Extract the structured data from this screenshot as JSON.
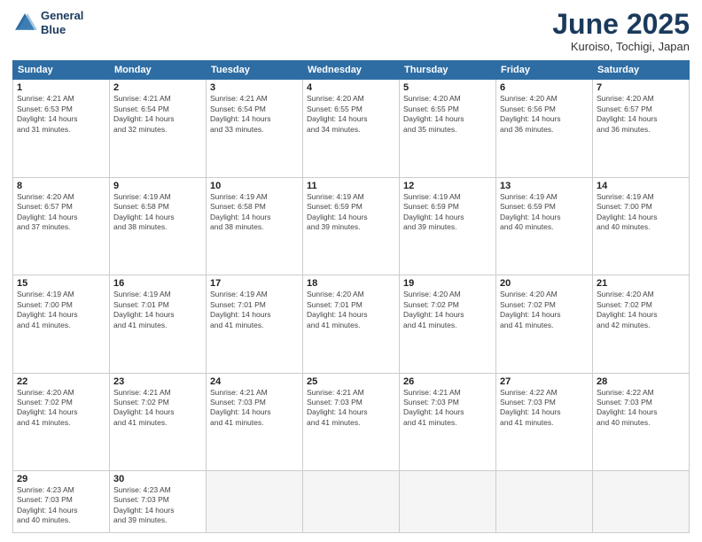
{
  "logo": {
    "line1": "General",
    "line2": "Blue"
  },
  "title": "June 2025",
  "location": "Kuroiso, Tochigi, Japan",
  "weekdays": [
    "Sunday",
    "Monday",
    "Tuesday",
    "Wednesday",
    "Thursday",
    "Friday",
    "Saturday"
  ],
  "weeks": [
    [
      {
        "day": "1",
        "info": "Sunrise: 4:21 AM\nSunset: 6:53 PM\nDaylight: 14 hours\nand 31 minutes."
      },
      {
        "day": "2",
        "info": "Sunrise: 4:21 AM\nSunset: 6:54 PM\nDaylight: 14 hours\nand 32 minutes."
      },
      {
        "day": "3",
        "info": "Sunrise: 4:21 AM\nSunset: 6:54 PM\nDaylight: 14 hours\nand 33 minutes."
      },
      {
        "day": "4",
        "info": "Sunrise: 4:20 AM\nSunset: 6:55 PM\nDaylight: 14 hours\nand 34 minutes."
      },
      {
        "day": "5",
        "info": "Sunrise: 4:20 AM\nSunset: 6:55 PM\nDaylight: 14 hours\nand 35 minutes."
      },
      {
        "day": "6",
        "info": "Sunrise: 4:20 AM\nSunset: 6:56 PM\nDaylight: 14 hours\nand 36 minutes."
      },
      {
        "day": "7",
        "info": "Sunrise: 4:20 AM\nSunset: 6:57 PM\nDaylight: 14 hours\nand 36 minutes."
      }
    ],
    [
      {
        "day": "8",
        "info": "Sunrise: 4:20 AM\nSunset: 6:57 PM\nDaylight: 14 hours\nand 37 minutes."
      },
      {
        "day": "9",
        "info": "Sunrise: 4:19 AM\nSunset: 6:58 PM\nDaylight: 14 hours\nand 38 minutes."
      },
      {
        "day": "10",
        "info": "Sunrise: 4:19 AM\nSunset: 6:58 PM\nDaylight: 14 hours\nand 38 minutes."
      },
      {
        "day": "11",
        "info": "Sunrise: 4:19 AM\nSunset: 6:59 PM\nDaylight: 14 hours\nand 39 minutes."
      },
      {
        "day": "12",
        "info": "Sunrise: 4:19 AM\nSunset: 6:59 PM\nDaylight: 14 hours\nand 39 minutes."
      },
      {
        "day": "13",
        "info": "Sunrise: 4:19 AM\nSunset: 6:59 PM\nDaylight: 14 hours\nand 40 minutes."
      },
      {
        "day": "14",
        "info": "Sunrise: 4:19 AM\nSunset: 7:00 PM\nDaylight: 14 hours\nand 40 minutes."
      }
    ],
    [
      {
        "day": "15",
        "info": "Sunrise: 4:19 AM\nSunset: 7:00 PM\nDaylight: 14 hours\nand 41 minutes."
      },
      {
        "day": "16",
        "info": "Sunrise: 4:19 AM\nSunset: 7:01 PM\nDaylight: 14 hours\nand 41 minutes."
      },
      {
        "day": "17",
        "info": "Sunrise: 4:19 AM\nSunset: 7:01 PM\nDaylight: 14 hours\nand 41 minutes."
      },
      {
        "day": "18",
        "info": "Sunrise: 4:20 AM\nSunset: 7:01 PM\nDaylight: 14 hours\nand 41 minutes."
      },
      {
        "day": "19",
        "info": "Sunrise: 4:20 AM\nSunset: 7:02 PM\nDaylight: 14 hours\nand 41 minutes."
      },
      {
        "day": "20",
        "info": "Sunrise: 4:20 AM\nSunset: 7:02 PM\nDaylight: 14 hours\nand 41 minutes."
      },
      {
        "day": "21",
        "info": "Sunrise: 4:20 AM\nSunset: 7:02 PM\nDaylight: 14 hours\nand 42 minutes."
      }
    ],
    [
      {
        "day": "22",
        "info": "Sunrise: 4:20 AM\nSunset: 7:02 PM\nDaylight: 14 hours\nand 41 minutes."
      },
      {
        "day": "23",
        "info": "Sunrise: 4:21 AM\nSunset: 7:02 PM\nDaylight: 14 hours\nand 41 minutes."
      },
      {
        "day": "24",
        "info": "Sunrise: 4:21 AM\nSunset: 7:03 PM\nDaylight: 14 hours\nand 41 minutes."
      },
      {
        "day": "25",
        "info": "Sunrise: 4:21 AM\nSunset: 7:03 PM\nDaylight: 14 hours\nand 41 minutes."
      },
      {
        "day": "26",
        "info": "Sunrise: 4:21 AM\nSunset: 7:03 PM\nDaylight: 14 hours\nand 41 minutes."
      },
      {
        "day": "27",
        "info": "Sunrise: 4:22 AM\nSunset: 7:03 PM\nDaylight: 14 hours\nand 41 minutes."
      },
      {
        "day": "28",
        "info": "Sunrise: 4:22 AM\nSunset: 7:03 PM\nDaylight: 14 hours\nand 40 minutes."
      }
    ],
    [
      {
        "day": "29",
        "info": "Sunrise: 4:23 AM\nSunset: 7:03 PM\nDaylight: 14 hours\nand 40 minutes."
      },
      {
        "day": "30",
        "info": "Sunrise: 4:23 AM\nSunset: 7:03 PM\nDaylight: 14 hours\nand 39 minutes."
      },
      null,
      null,
      null,
      null,
      null
    ]
  ]
}
